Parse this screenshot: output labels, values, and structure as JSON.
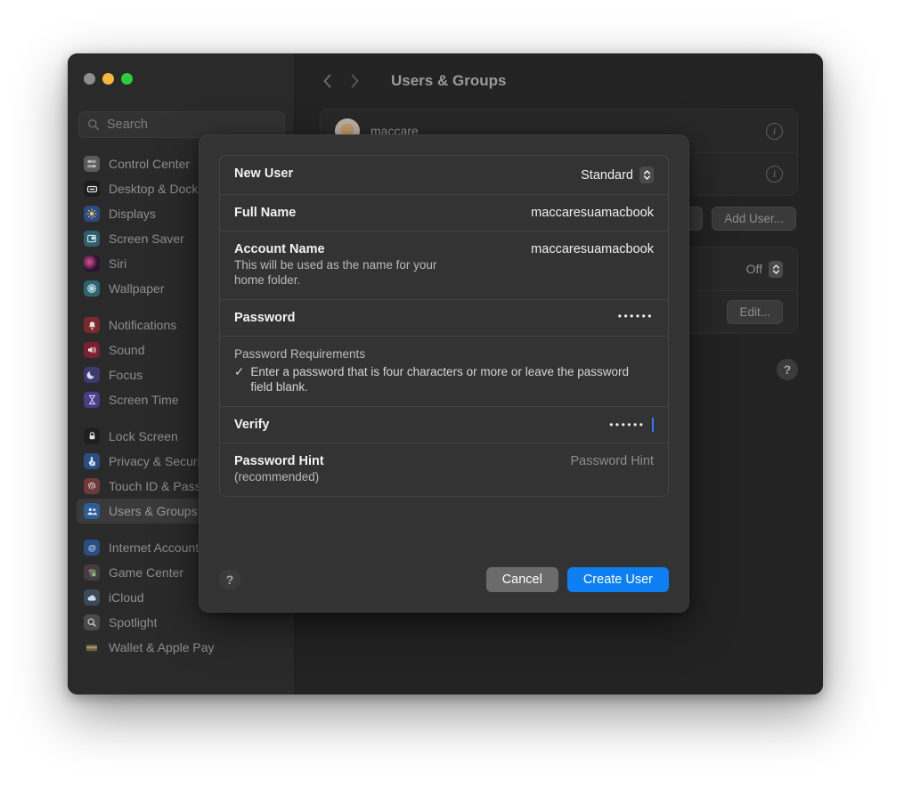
{
  "window": {
    "traffic_lights": [
      "close",
      "minimize",
      "zoom"
    ],
    "search": {
      "placeholder": "Search",
      "value": "",
      "icon": "search-icon"
    }
  },
  "sidebar": {
    "groups": [
      {
        "items": [
          {
            "label": "Control Center",
            "icon": "control-center-icon",
            "color": "#5b5b5b"
          },
          {
            "label": "Desktop & Dock",
            "icon": "desktop-dock-icon",
            "color": "#1d1d1d"
          },
          {
            "label": "Displays",
            "icon": "displays-icon",
            "color": "#2b4a7e"
          },
          {
            "label": "Screen Saver",
            "icon": "screen-saver-icon",
            "color": "#2f5f6e"
          },
          {
            "label": "Siri",
            "icon": "siri-icon",
            "color": "#4a2440"
          },
          {
            "label": "Wallpaper",
            "icon": "wallpaper-icon",
            "color": "#2f6470"
          }
        ]
      },
      {
        "items": [
          {
            "label": "Notifications",
            "icon": "notifications-icon",
            "color": "#7a2a2a"
          },
          {
            "label": "Sound",
            "icon": "sound-icon",
            "color": "#7a2030"
          },
          {
            "label": "Focus",
            "icon": "focus-icon",
            "color": "#3b3b6e"
          },
          {
            "label": "Screen Time",
            "icon": "screen-time-icon",
            "color": "#473e8a"
          }
        ]
      },
      {
        "items": [
          {
            "label": "Lock Screen",
            "icon": "lock-screen-icon",
            "color": "#1f1f1f"
          },
          {
            "label": "Privacy & Security",
            "icon": "privacy-security-icon",
            "color": "#2a4d82"
          },
          {
            "label": "Touch ID & Password",
            "icon": "touch-id-icon",
            "color": "#6b3b3b"
          },
          {
            "label": "Users & Groups",
            "icon": "users-groups-icon",
            "color": "#2e5d96",
            "selected": true
          }
        ]
      },
      {
        "items": [
          {
            "label": "Internet Accounts",
            "icon": "internet-accounts-icon",
            "color": "#2a4d82"
          },
          {
            "label": "Game Center",
            "icon": "game-center-icon",
            "color": "#3f3f3f"
          },
          {
            "label": "iCloud",
            "icon": "icloud-icon",
            "color": "#3c4a58"
          },
          {
            "label": "Spotlight",
            "icon": "spotlight-icon",
            "color": "#4a4a4a"
          },
          {
            "label": "Wallet & Apple Pay",
            "icon": "wallet-apple-pay-icon",
            "color": "#2c2c2c"
          }
        ]
      }
    ]
  },
  "main": {
    "nav": {
      "back": "chevron-left-icon",
      "forward": "chevron-right-icon"
    },
    "title": "Users & Groups",
    "users": [
      {
        "name": "maccare",
        "info": "info-icon"
      },
      {
        "name": "",
        "info": "info-icon"
      }
    ],
    "buttons": {
      "secondary": "...",
      "add_user": "Add User..."
    },
    "options": [
      {
        "value": "Off",
        "control": "popup-stepper"
      },
      {
        "action": "Edit...",
        "control": "button"
      }
    ],
    "help": "?"
  },
  "sheet": {
    "rows": [
      {
        "label": "New User",
        "value": "Standard",
        "control": "popup-button",
        "kind": "popup"
      },
      {
        "label": "Full Name",
        "value": "maccaresuamacbook",
        "kind": "text"
      },
      {
        "label": "Account Name",
        "sublabel": "This will be used as the name for your home folder.",
        "value": "maccaresuamacbook",
        "kind": "text"
      },
      {
        "label": "Password",
        "value": "••••••",
        "kind": "secure"
      }
    ],
    "requirements": {
      "title": "Password Requirements",
      "check": "✓",
      "text": "Enter a password that is four characters or more or leave the password field blank."
    },
    "verify": {
      "label": "Verify",
      "value": "••••••",
      "focused": true
    },
    "hint": {
      "label": "Password Hint",
      "sublabel": "(recommended)",
      "placeholder": "Password Hint",
      "value": ""
    },
    "footer": {
      "help": "?",
      "cancel": "Cancel",
      "create": "Create User"
    }
  },
  "colors": {
    "accent": "#0d7ff2",
    "window_bg": "#232323",
    "sidebar_bg": "#2a2a2a",
    "sheet_bg": "#333333",
    "caret": "#2b7cf6"
  }
}
